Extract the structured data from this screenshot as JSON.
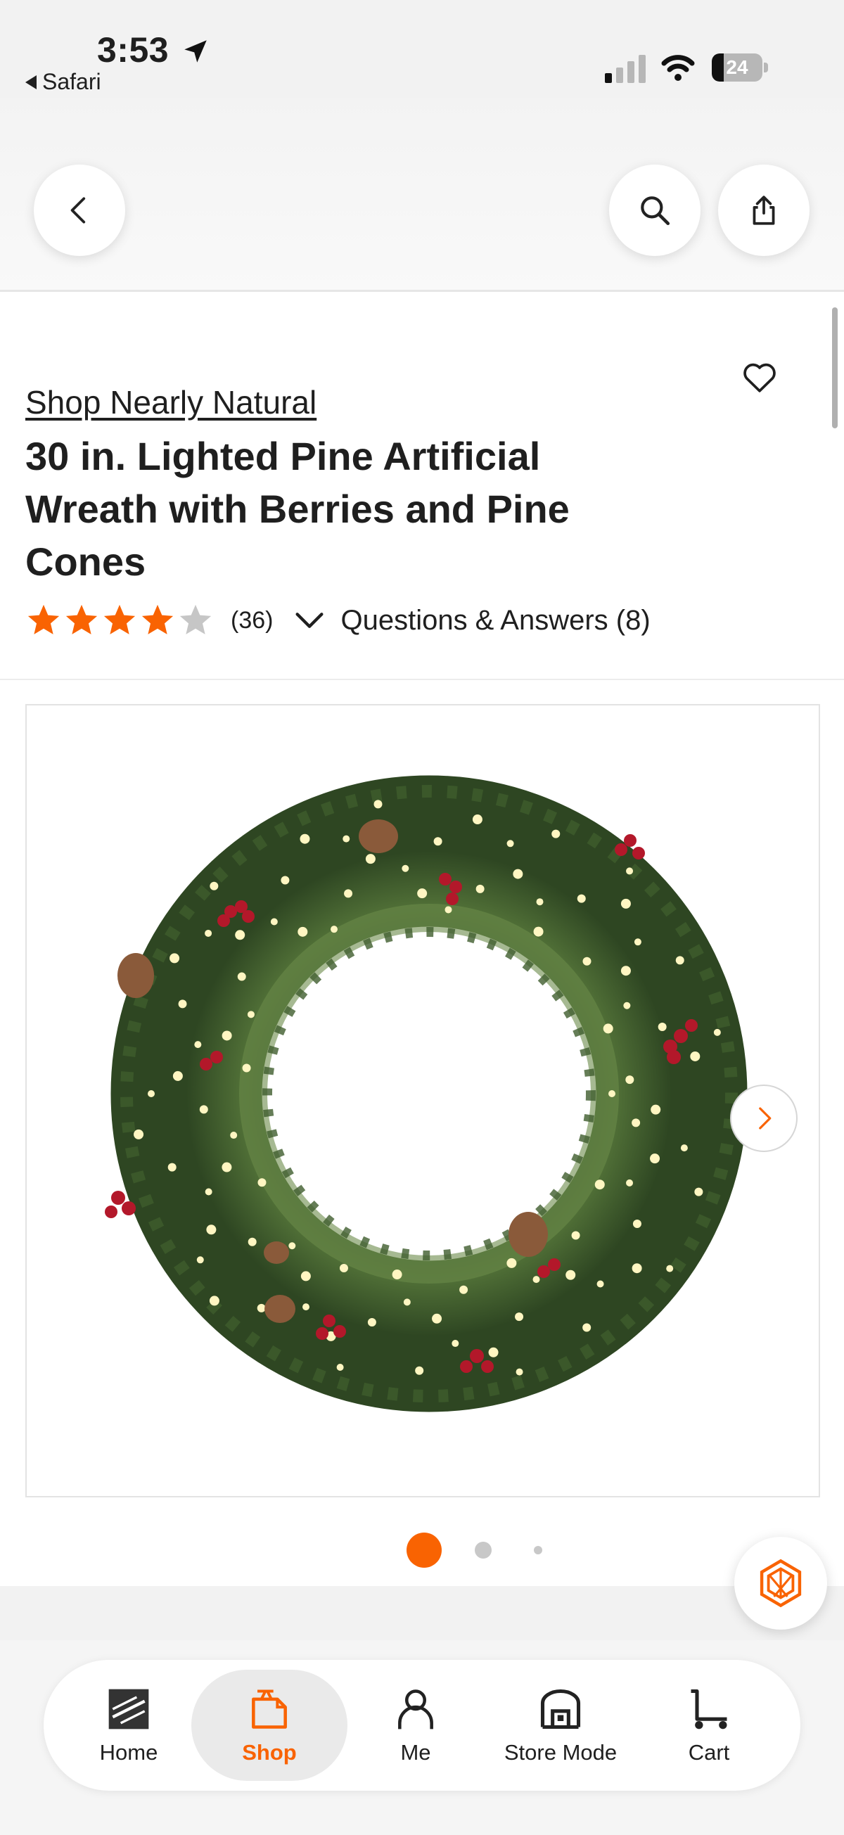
{
  "status_bar": {
    "time": "3:53",
    "back_app": "Safari",
    "battery": "24",
    "battery_level": 0.24
  },
  "nav": {
    "back_icon": "chevron-left-icon",
    "search_icon": "search-icon",
    "share_icon": "share-icon"
  },
  "product": {
    "brand": "Shop Nearly Natural",
    "title": "30 in. Lighted Pine Artificial Wreath with Berries and Pine Cones",
    "rating": 4,
    "rating_max": 5,
    "review_count": "(36)",
    "qa_label": "Questions & Answers (8)"
  },
  "gallery": {
    "image_count": 3,
    "active_index": 0,
    "image_subject": "wreath"
  },
  "tabs": [
    {
      "label": "Home",
      "icon": "home-depot-logo-icon"
    },
    {
      "label": "Shop",
      "icon": "shop-bag-icon",
      "active": true
    },
    {
      "label": "Me",
      "icon": "person-icon"
    },
    {
      "label": "Store Mode",
      "icon": "store-icon"
    },
    {
      "label": "Cart",
      "icon": "cart-icon"
    }
  ],
  "colors": {
    "accent": "#f96302",
    "star": "#f96302",
    "star_empty": "#c6c6c6"
  }
}
